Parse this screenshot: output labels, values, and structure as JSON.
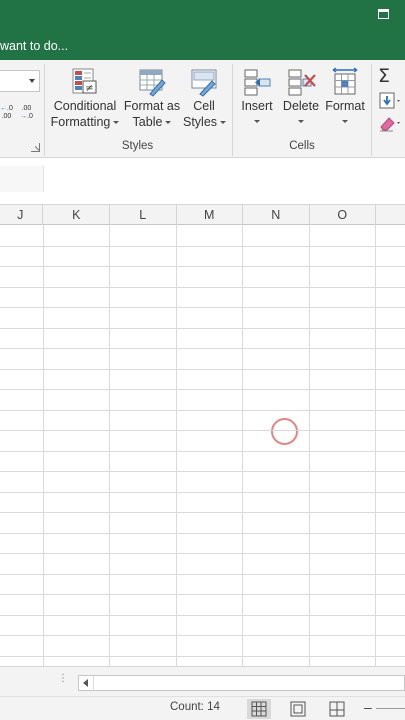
{
  "title_bar": {
    "restore_icon": "restore-window-icon",
    "bg_color": "#217346"
  },
  "tell_me": {
    "text": "want to do..."
  },
  "ribbon": {
    "number_format": {
      "value": ""
    },
    "decimal_buttons": {
      "increase_label": ".0 .00",
      "decrease_label": ".00 .0"
    },
    "styles": {
      "conditional_formatting": {
        "line1": "Conditional",
        "line2": "Formatting"
      },
      "format_as_table": {
        "line1": "Format as",
        "line2": "Table"
      },
      "cell_styles": {
        "line1": "Cell",
        "line2": "Styles"
      },
      "group_label": "Styles"
    },
    "cells": {
      "insert": {
        "label": "Insert"
      },
      "delete": {
        "label": "Delete"
      },
      "format": {
        "label": "Format"
      },
      "group_label": "Cells"
    },
    "editing": {
      "autosum_icon": "sigma-icon",
      "fill_icon": "fill-down-icon",
      "clear_icon": "eraser-icon"
    }
  },
  "columns": [
    "J",
    "K",
    "L",
    "M",
    "N",
    "O"
  ],
  "status_bar": {
    "count_text": "Count: 14",
    "views": [
      "normal-view-icon",
      "page-layout-view-icon",
      "page-break-preview-icon"
    ],
    "zoom_out": "–"
  },
  "colors": {
    "accent_green": "#217346",
    "ribbon_bg": "#f3f3f3",
    "grid_line": "#dadada",
    "cursor_ring": "#e8827e"
  }
}
